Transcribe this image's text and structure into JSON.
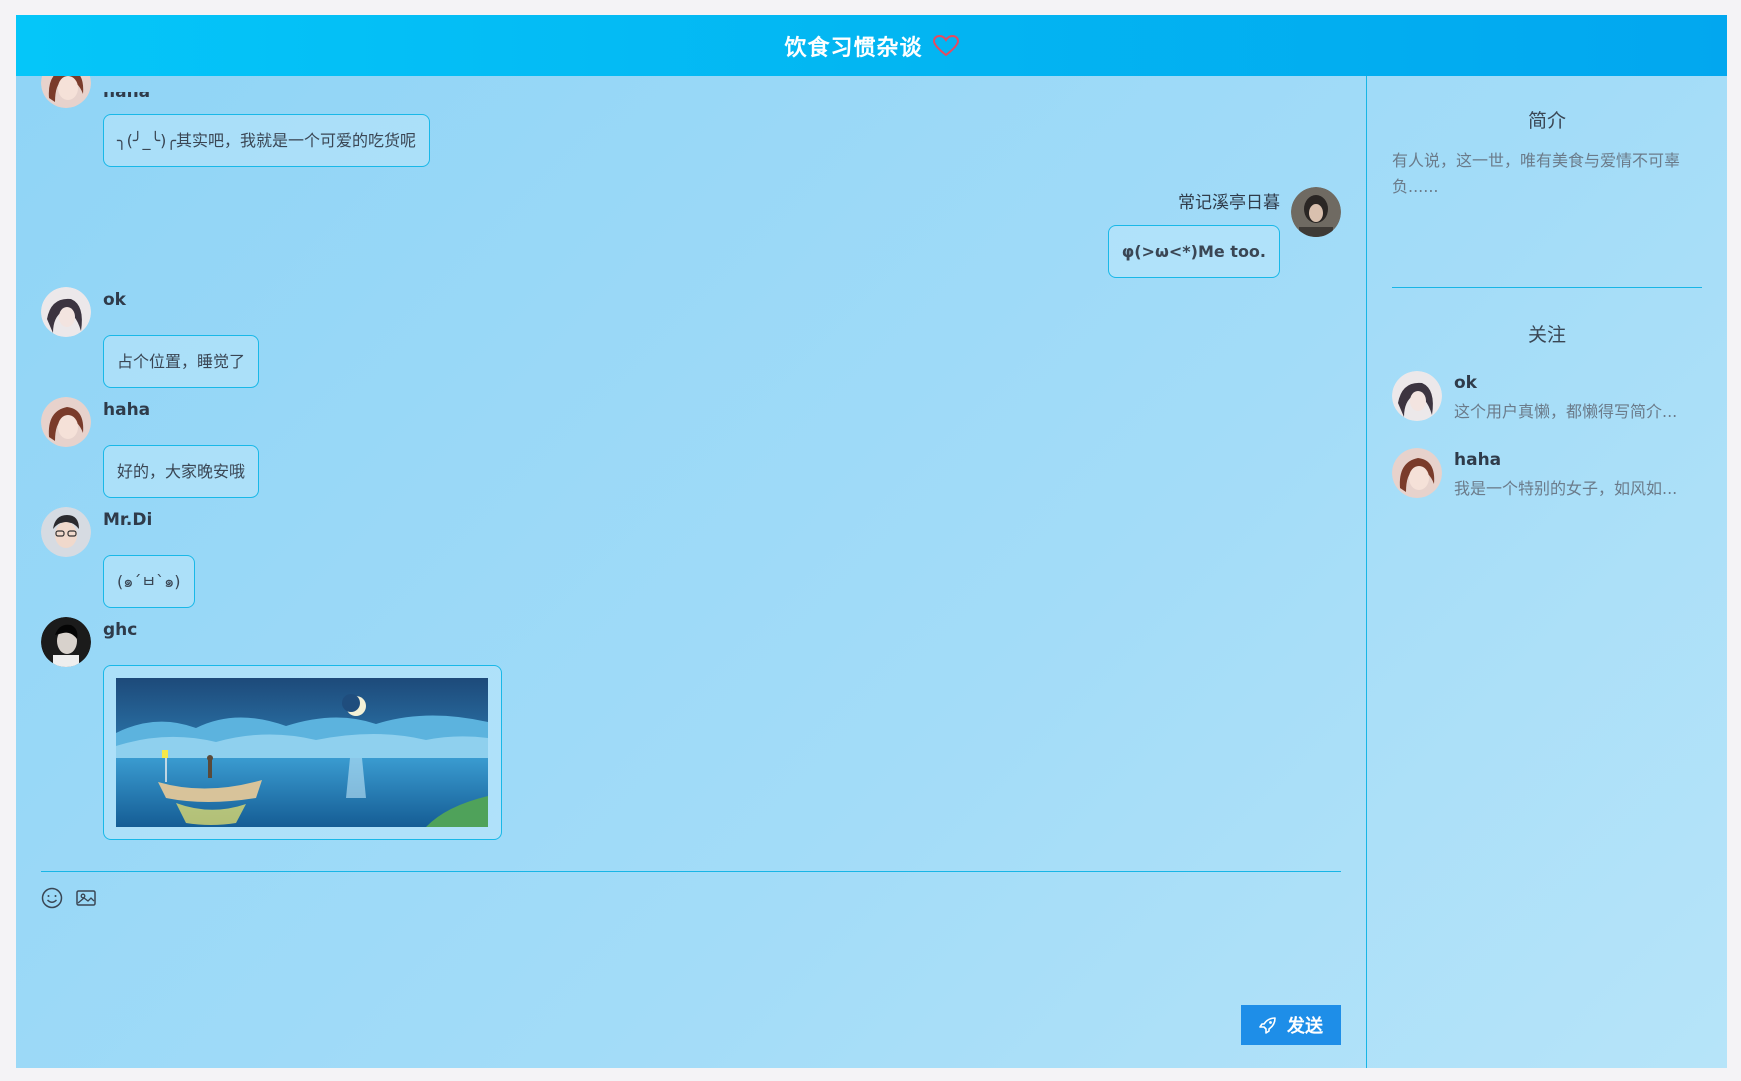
{
  "header": {
    "title": "饮食习惯杂谈",
    "heart_color": "#e84a5f"
  },
  "messages": [
    {
      "user": "haha",
      "text": "╮(╯_╰)╭其实吧，我就是一个可爱的吃货呢",
      "side": "left"
    },
    {
      "user": "常记溪亭日暮",
      "text": "φ(>ω<*)Me too.",
      "side": "right"
    },
    {
      "user": "ok",
      "text": "占个位置，睡觉了",
      "side": "left"
    },
    {
      "user": "haha",
      "text": "好的，大家晚安哦",
      "side": "left"
    },
    {
      "user": "Mr.Di",
      "text": "(๑´ㅂ`๑)",
      "side": "left"
    },
    {
      "user": "ghc",
      "image": "night-lake-boat",
      "side": "left"
    }
  ],
  "toolbar": {
    "emoji_icon": "smile-icon",
    "image_icon": "image-icon"
  },
  "send": {
    "label": "发送",
    "icon": "rocket-icon",
    "color": "#1e8ee8"
  },
  "sidebar": {
    "intro_title": "简介",
    "intro_text": "有人说，这一世，唯有美食与爱情不可辜负......",
    "follow_title": "关注",
    "follows": [
      {
        "name": "ok",
        "desc": "这个用户真懒，都懒得写简介..."
      },
      {
        "name": "haha",
        "desc": "我是一个特别的女子，如风如..."
      }
    ]
  },
  "colors": {
    "accent": "#18b5e6",
    "header_start": "#05c6f9",
    "header_end": "#02a7ef"
  }
}
